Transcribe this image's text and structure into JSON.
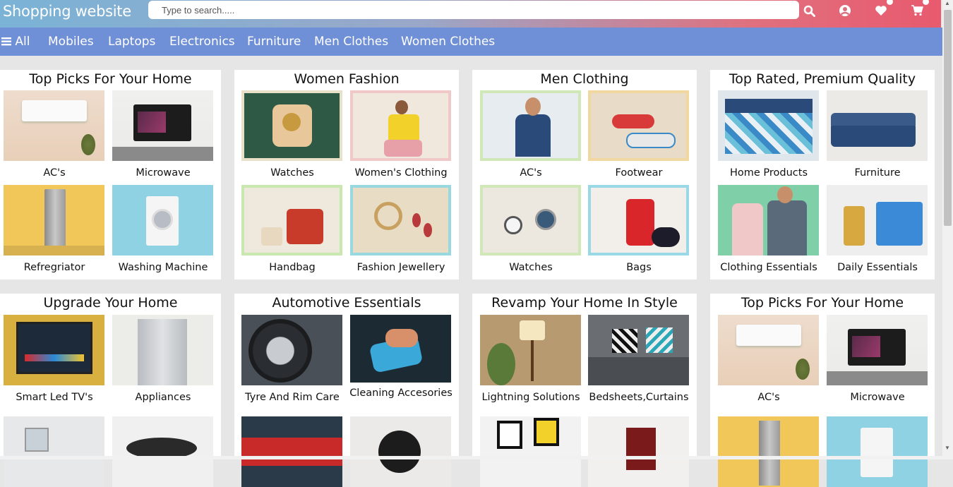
{
  "brand": "Shopping website",
  "search": {
    "placeholder": "Type to search....."
  },
  "header_icons": [
    "search-icon",
    "user-icon",
    "heart-icon",
    "cart-icon"
  ],
  "nav": {
    "all_label": "All",
    "items": [
      "Mobiles",
      "Laptops",
      "Electronics",
      "Furniture",
      "Men Clothes",
      "Women Clothes"
    ]
  },
  "colors": {
    "nav_bg": "#6f8fd6",
    "page_bg": "#e6e6e6",
    "header_gradient_start": "#7ab3d6",
    "header_gradient_end": "#e85a6e"
  },
  "cards": [
    {
      "title": "Top Picks For Your Home",
      "items": [
        "AC's",
        "Microwave",
        "Refregriator",
        "Washing Machine"
      ]
    },
    {
      "title": "Women Fashion",
      "items": [
        "Watches",
        "Women's Clothing",
        "Handbag",
        "Fashion Jewellery"
      ]
    },
    {
      "title": "Men Clothing",
      "items": [
        "AC's",
        "Footwear",
        "Watches",
        "Bags"
      ]
    },
    {
      "title": "Top Rated, Premium Quality",
      "items": [
        "Home Products",
        "Furniture",
        "Clothing Essentials",
        "Daily Essentials"
      ]
    },
    {
      "title": "Upgrade Your Home",
      "items": [
        "Smart Led TV's",
        "Appliances",
        "",
        ""
      ]
    },
    {
      "title": "Automotive Essentials",
      "items": [
        "Tyre And Rim Care",
        "Cleaning Accesories",
        "",
        ""
      ]
    },
    {
      "title": "Revamp Your Home In Style",
      "items": [
        "Lightning Solutions",
        "Bedsheets,Curtains",
        "",
        ""
      ]
    },
    {
      "title": "Top Picks For Your Home",
      "items": [
        "AC's",
        "Microwave",
        "",
        ""
      ]
    }
  ]
}
